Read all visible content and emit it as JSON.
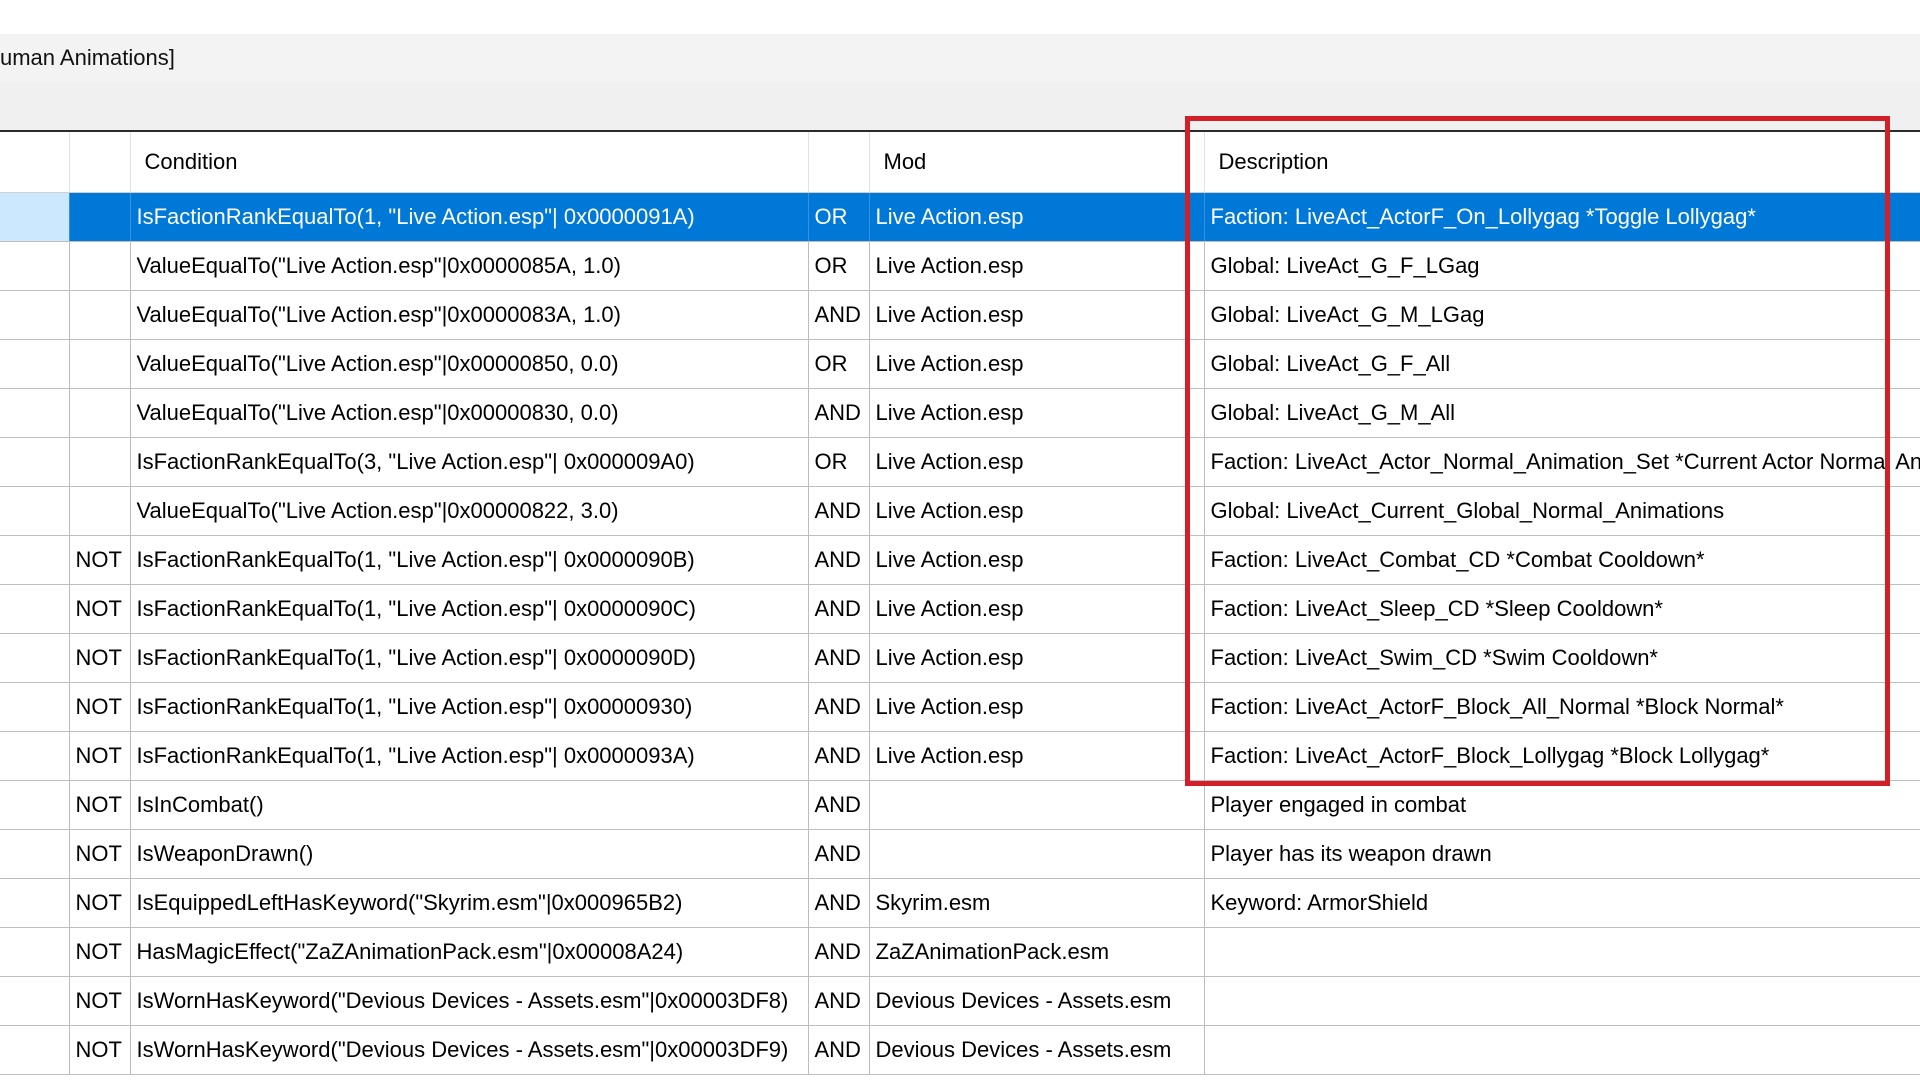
{
  "window": {
    "title_fragment": "uman Animations]"
  },
  "columns": {
    "not": "",
    "condition": "Condition",
    "operator": "",
    "mod": "Mod",
    "description": "Description"
  },
  "rows": [
    {
      "not": "",
      "condition": "IsFactionRankEqualTo(1, \"Live Action.esp\"| 0x0000091A)",
      "op": "OR",
      "mod": "Live Action.esp",
      "desc": "Faction: LiveAct_ActorF_On_Lollygag *Toggle Lollygag*"
    },
    {
      "not": "",
      "condition": "ValueEqualTo(\"Live Action.esp\"|0x0000085A, 1.0)",
      "op": "OR",
      "mod": "Live Action.esp",
      "desc": "Global: LiveAct_G_F_LGag"
    },
    {
      "not": "",
      "condition": "ValueEqualTo(\"Live Action.esp\"|0x0000083A, 1.0)",
      "op": "AND",
      "mod": "Live Action.esp",
      "desc": "Global: LiveAct_G_M_LGag"
    },
    {
      "not": "",
      "condition": "ValueEqualTo(\"Live Action.esp\"|0x00000850, 0.0)",
      "op": "OR",
      "mod": "Live Action.esp",
      "desc": "Global: LiveAct_G_F_All"
    },
    {
      "not": "",
      "condition": "ValueEqualTo(\"Live Action.esp\"|0x00000830, 0.0)",
      "op": "AND",
      "mod": "Live Action.esp",
      "desc": "Global: LiveAct_G_M_All"
    },
    {
      "not": "",
      "condition": "IsFactionRankEqualTo(3, \"Live Action.esp\"| 0x000009A0)",
      "op": "OR",
      "mod": "Live Action.esp",
      "desc": "Faction: LiveAct_Actor_Normal_Animation_Set *Current Actor Normal Animat"
    },
    {
      "not": "",
      "condition": "ValueEqualTo(\"Live Action.esp\"|0x00000822, 3.0)",
      "op": "AND",
      "mod": "Live Action.esp",
      "desc": "Global: LiveAct_Current_Global_Normal_Animations"
    },
    {
      "not": "NOT",
      "condition": "IsFactionRankEqualTo(1, \"Live Action.esp\"| 0x0000090B)",
      "op": "AND",
      "mod": "Live Action.esp",
      "desc": "Faction: LiveAct_Combat_CD *Combat Cooldown*"
    },
    {
      "not": "NOT",
      "condition": "IsFactionRankEqualTo(1, \"Live Action.esp\"| 0x0000090C)",
      "op": "AND",
      "mod": "Live Action.esp",
      "desc": "Faction: LiveAct_Sleep_CD *Sleep Cooldown*"
    },
    {
      "not": "NOT",
      "condition": "IsFactionRankEqualTo(1, \"Live Action.esp\"| 0x0000090D)",
      "op": "AND",
      "mod": "Live Action.esp",
      "desc": "Faction: LiveAct_Swim_CD *Swim Cooldown*"
    },
    {
      "not": "NOT",
      "condition": "IsFactionRankEqualTo(1, \"Live Action.esp\"| 0x00000930)",
      "op": "AND",
      "mod": "Live Action.esp",
      "desc": "Faction: LiveAct_ActorF_Block_All_Normal *Block Normal*"
    },
    {
      "not": "NOT",
      "condition": "IsFactionRankEqualTo(1, \"Live Action.esp\"| 0x0000093A)",
      "op": "AND",
      "mod": "Live Action.esp",
      "desc": "Faction: LiveAct_ActorF_Block_Lollygag *Block Lollygag*"
    },
    {
      "not": "NOT",
      "condition": "IsInCombat()",
      "op": "AND",
      "mod": "",
      "desc": "Player engaged in combat"
    },
    {
      "not": "NOT",
      "condition": "IsWeaponDrawn()",
      "op": "AND",
      "mod": "",
      "desc": "Player has its weapon drawn"
    },
    {
      "not": "NOT",
      "condition": "IsEquippedLeftHasKeyword(\"Skyrim.esm\"|0x000965B2)",
      "op": "AND",
      "mod": "Skyrim.esm",
      "desc": "Keyword: ArmorShield"
    },
    {
      "not": "NOT",
      "condition": "HasMagicEffect(\"ZaZAnimationPack.esm\"|0x00008A24)",
      "op": "AND",
      "mod": "ZaZAnimationPack.esm",
      "desc": ""
    },
    {
      "not": "NOT",
      "condition": "IsWornHasKeyword(\"Devious Devices - Assets.esm\"|0x00003DF8)",
      "op": "AND",
      "mod": "Devious Devices - Assets.esm",
      "desc": ""
    },
    {
      "not": "NOT",
      "condition": "IsWornHasKeyword(\"Devious Devices - Assets.esm\"|0x00003DF9)",
      "op": "AND",
      "mod": "Devious Devices - Assets.esm",
      "desc": ""
    }
  ],
  "selected_row": 0,
  "highlight": {
    "color": "#d32028",
    "target": "description-column"
  },
  "colors": {
    "selection": "#0078d7",
    "selection_row_header": "#cce8ff"
  }
}
